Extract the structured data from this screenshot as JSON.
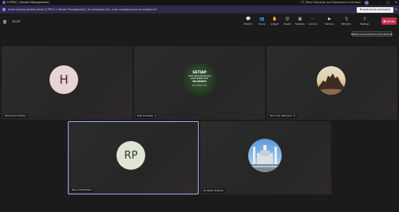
{
  "titlebar": {
    "title": "E-PROC | Vendor Management)",
    "org": "PT. Pekon Operation and Maintenance Indonesia",
    "window_buttons": [
      "–",
      "□",
      "✕"
    ]
  },
  "banner": {
    "text": "Anda sedang berada dalam E-PROC | Vendor Management). Di perangkat lain, ingin bergabung ke perangkat ini?",
    "button_label": "Bergabung ke perangkat",
    "close": "✕"
  },
  "toolbar": {
    "timer": "10:10",
    "tools": [
      {
        "id": "chat",
        "label": "Obrolan",
        "icon": "💬"
      },
      {
        "id": "people",
        "label": "Orang",
        "icon": "👥"
      },
      {
        "id": "raise",
        "label": "Angkat",
        "icon": "✋"
      },
      {
        "id": "react",
        "label": "Reaksi",
        "icon": "☺"
      },
      {
        "id": "view",
        "label": "Tampilan",
        "icon": "▦"
      },
      {
        "id": "more",
        "label": "Lainnya",
        "icon": "⋯"
      },
      {
        "id": "camera",
        "label": "Kamera",
        "icon": "▶"
      },
      {
        "id": "mic",
        "label": "Mikrofon",
        "icon": "🎙"
      },
      {
        "id": "share",
        "label": "Berbagi",
        "icon": "⇧"
      }
    ],
    "leave_label": "Keluar",
    "leave_icon": "☎",
    "tooltip": "Matikan suara mikrofon (Ctrl+Shift+M)"
  },
  "participants": [
    {
      "name": "Tamuonline (Tamu)",
      "initials": "H",
      "kind": "initials",
      "muted": false,
      "circle_color": "#e8d3d5",
      "initials_color": "#3a2a2a"
    },
    {
      "name": "Rudi Gunawan",
      "kind": "setiap",
      "muted": true,
      "image_text": [
        "SETIAP",
        "TAHAP YANG KITA LAKUKAN",
        "AKAN KEMBALI PADA",
        "PELAKUNYA",
        "#my bike cross"
      ]
    },
    {
      "name": "Feny Yuni Saboyono",
      "kind": "photo-rock",
      "muted": true
    },
    {
      "name": "Riyo Arip Pradana",
      "initials": "RP",
      "kind": "initials",
      "muted": false,
      "circle_color": "#dfe4d3",
      "initials_color": "#2e3a2e"
    },
    {
      "name": "M. Faisal Harahap",
      "kind": "photo-mosque",
      "muted": false
    }
  ],
  "colors": {
    "leave": "#c4314b",
    "accent": "#8b8cf0",
    "selected_border": "#a7a6f5"
  }
}
